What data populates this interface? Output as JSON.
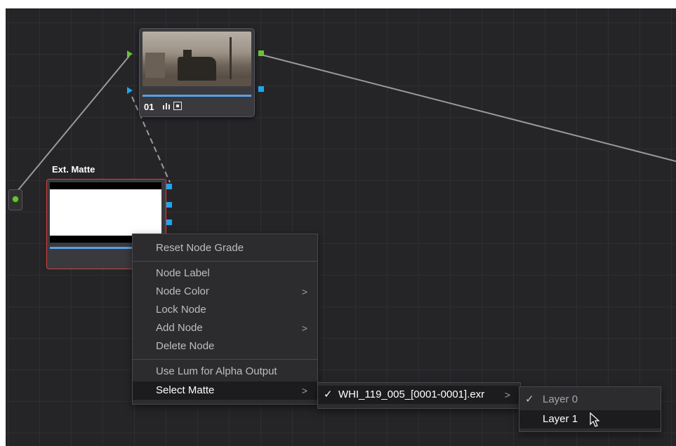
{
  "node_editor": {
    "node01": {
      "label": "01",
      "icons": [
        "levels-icon",
        "clip-icon"
      ]
    },
    "ext_matte": {
      "title": "Ext. Matte"
    }
  },
  "context_menu": {
    "items": [
      {
        "label": "Reset Node Grade"
      },
      {
        "label": "Node Label"
      },
      {
        "label": "Node Color",
        "submenu": true
      },
      {
        "label": "Lock Node"
      },
      {
        "label": "Add Node",
        "submenu": true
      },
      {
        "label": "Delete Node"
      },
      {
        "label": "Use Lum for Alpha Output"
      },
      {
        "label": "Select Matte",
        "submenu": true,
        "highlighted": true
      }
    ]
  },
  "matte_submenu": {
    "items": [
      {
        "label": "WHI_119_005_[0001-0001].exr",
        "checked": true,
        "submenu": true
      }
    ]
  },
  "layer_submenu": {
    "items": [
      {
        "label": "Layer 0",
        "checked": true
      },
      {
        "label": "Layer 1",
        "hovered": true
      }
    ]
  },
  "colors": {
    "highlight": "#1c1c1e",
    "matte_border": "#d6403d",
    "green_port": "#69c431",
    "blue_port": "#1ca6f0"
  }
}
